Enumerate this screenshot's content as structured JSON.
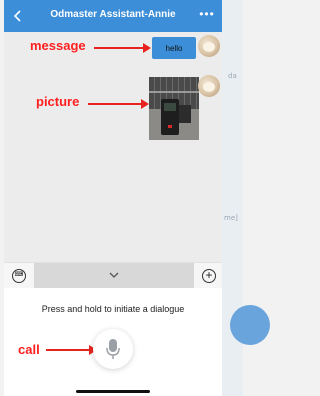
{
  "header": {
    "title": "Odmaster Assistant-Annie",
    "more_label": "•••"
  },
  "background_page": {
    "text_1": "da",
    "text_2": "me]"
  },
  "chat": {
    "message_bubble": "hello"
  },
  "annotations": {
    "message": "message",
    "picture": "picture",
    "call": "call"
  },
  "voice_panel": {
    "prompt": "Press and hold to initiate a dialogue"
  },
  "colors": {
    "accent": "#3c8ed8",
    "annotation": "#ff1f1f"
  },
  "icons": {
    "back": "chevron-left-icon",
    "more": "more-icon",
    "keyboard": "keyboard-icon",
    "collapse": "chevron-down-icon",
    "add": "plus-icon",
    "mic": "microphone-icon"
  }
}
